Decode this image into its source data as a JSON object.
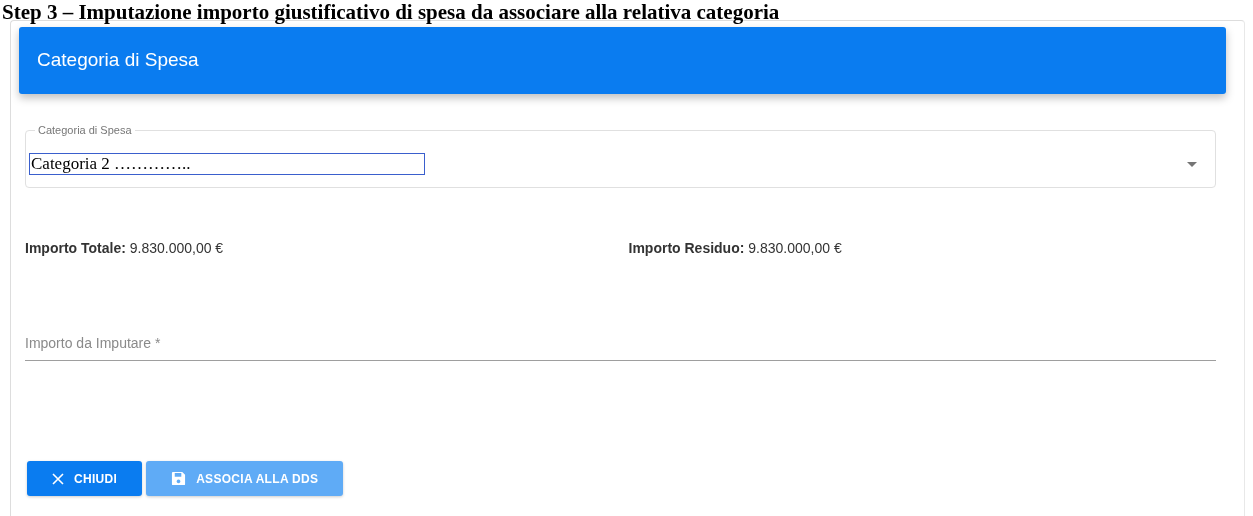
{
  "heading": "Step 3 – Imputazione importo giustificativo di spesa da associare alla relativa categoria",
  "card": {
    "title": "Categoria di Spesa"
  },
  "select": {
    "label": "Categoria di Spesa",
    "value": "Categoria 2 ………….."
  },
  "amounts": [
    {
      "label": "Importo Totale:",
      "value": "9.830.000,00 €"
    },
    {
      "label": "Importo Residuo:",
      "value": "9.830.000,00 €"
    }
  ],
  "amount_field": {
    "placeholder": "Importo da Imputare *"
  },
  "buttons": [
    {
      "kind": "close",
      "label": "CHIUDI",
      "disabled": false
    },
    {
      "kind": "save",
      "label": "ASSOCIA ALLA DDS",
      "disabled": true
    }
  ]
}
